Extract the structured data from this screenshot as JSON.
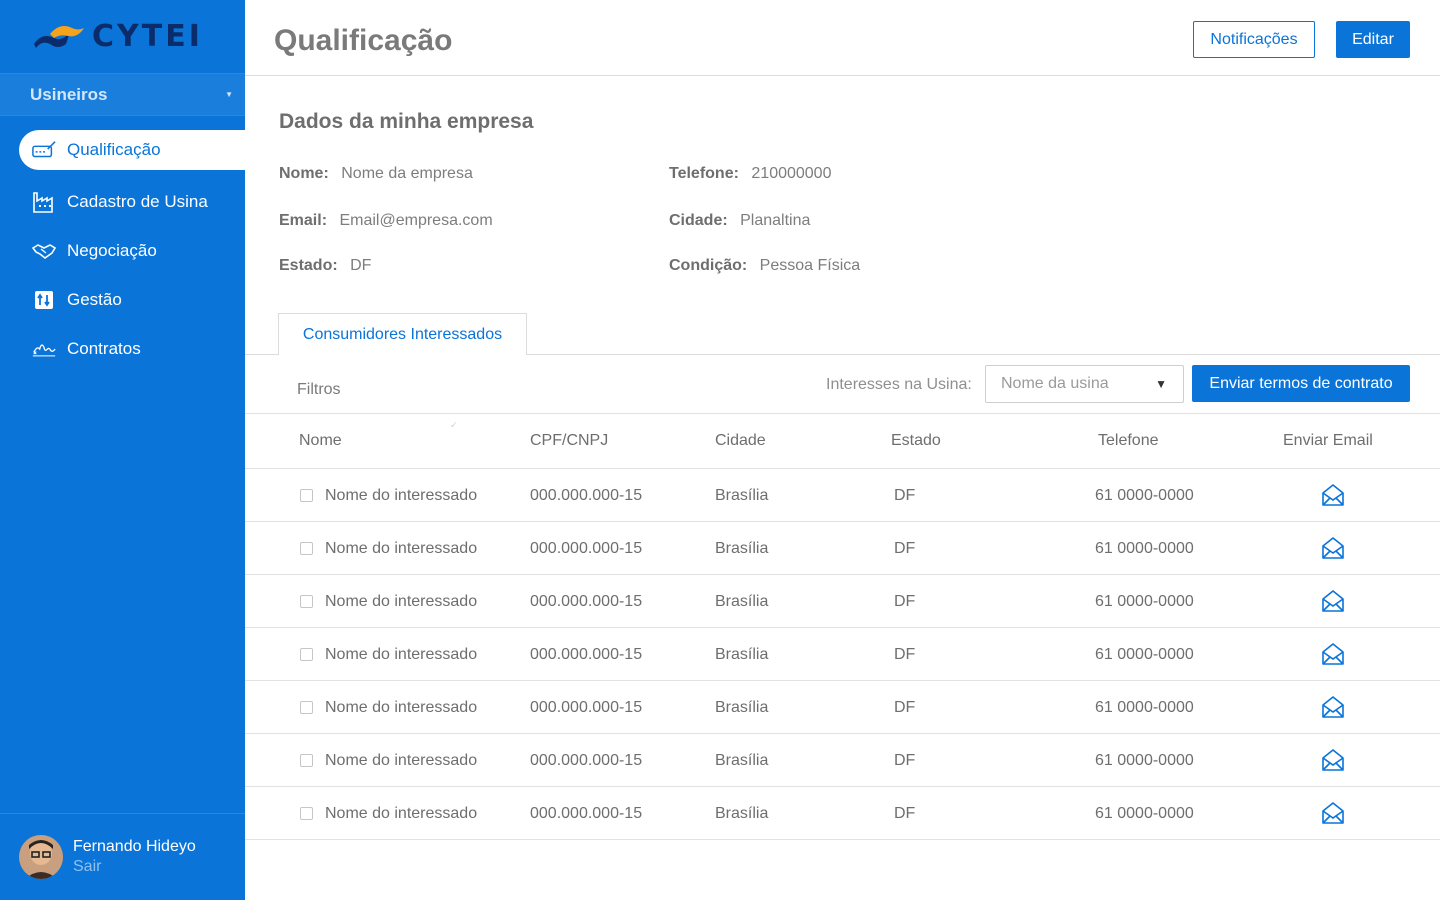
{
  "app": {
    "logo": "CYTEI"
  },
  "sidebar": {
    "role": "Usineiros",
    "items": [
      {
        "label": "Qualificação",
        "icon": "qualification-icon",
        "active": true
      },
      {
        "label": "Cadastro de Usina",
        "icon": "factory-icon",
        "active": false
      },
      {
        "label": "Negociação",
        "icon": "handshake-icon",
        "active": false
      },
      {
        "label": "Gestão",
        "icon": "management-icon",
        "active": false
      },
      {
        "label": "Contratos",
        "icon": "signature-icon",
        "active": false
      }
    ],
    "user": {
      "name": "Fernando Hideyo",
      "logout": "Sair"
    }
  },
  "header": {
    "title": "Qualificação",
    "notifications_label": "Notificações",
    "edit_label": "Editar"
  },
  "company": {
    "title": "Dados da minha empresa",
    "name_label": "Nome:",
    "name": "Nome da empresa",
    "phone_label": "Telefone:",
    "phone": "210000000",
    "email_label": "Email:",
    "email": "Email@empresa.com",
    "city_label": "Cidade:",
    "city": "Planaltina",
    "state_label": "Estado:",
    "state": "DF",
    "condition_label": "Condição:",
    "condition": "Pessoa Física"
  },
  "tabs": {
    "active": "Consumidores Interessados"
  },
  "filters": {
    "label": "Filtros",
    "interest_label": "Interesses na Usina:",
    "plant_select": "Nome da usina",
    "send_button": "Enviar termos de contrato"
  },
  "table": {
    "headers": [
      "Nome",
      "CPF/CNPJ",
      "Cidade",
      "Estado",
      "Telefone",
      "Enviar Email"
    ],
    "rows": [
      {
        "name": "Nome do interessado",
        "doc": "000.000.000-15",
        "city": "Brasília",
        "state": "DF",
        "phone": "61 0000-0000"
      },
      {
        "name": "Nome do interessado",
        "doc": "000.000.000-15",
        "city": "Brasília",
        "state": "DF",
        "phone": "61 0000-0000"
      },
      {
        "name": "Nome do interessado",
        "doc": "000.000.000-15",
        "city": "Brasília",
        "state": "DF",
        "phone": "61 0000-0000"
      },
      {
        "name": "Nome do interessado",
        "doc": "000.000.000-15",
        "city": "Brasília",
        "state": "DF",
        "phone": "61 0000-0000"
      },
      {
        "name": "Nome do interessado",
        "doc": "000.000.000-15",
        "city": "Brasília",
        "state": "DF",
        "phone": "61 0000-0000"
      },
      {
        "name": "Nome do interessado",
        "doc": "000.000.000-15",
        "city": "Brasília",
        "state": "DF",
        "phone": "61 0000-0000"
      },
      {
        "name": "Nome do interessado",
        "doc": "000.000.000-15",
        "city": "Brasília",
        "state": "DF",
        "phone": "61 0000-0000"
      }
    ]
  },
  "colors": {
    "primary": "#0a74d9",
    "logo_dark": "#0b2c6a",
    "logo_orange": "#f7a21b"
  }
}
